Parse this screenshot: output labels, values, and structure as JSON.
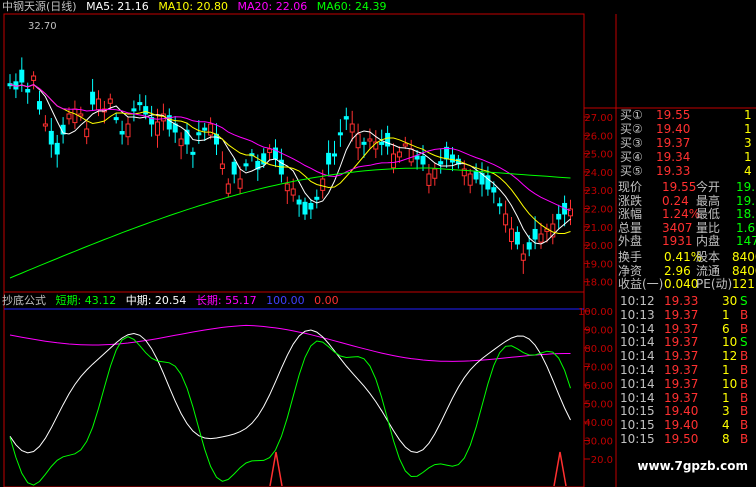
{
  "main_header": {
    "title": "中钢天源(日线)",
    "ma": [
      {
        "label": "MA5: 21.16",
        "color": "#ffffff"
      },
      {
        "label": "MA10: 20.80",
        "color": "#ffff00"
      },
      {
        "label": "MA20: 22.06",
        "color": "#ff00ff"
      },
      {
        "label": "MA60: 24.39",
        "color": "#00ff00"
      }
    ],
    "peak_label": "32.70",
    "low_marker": "18.92"
  },
  "price_axis": [
    "27.00",
    "26.00",
    "25.00",
    "24.00",
    "23.00",
    "22.00",
    "21.00",
    "20.00",
    "19.00",
    "18.00"
  ],
  "indicator_header": {
    "name": "抄底公式",
    "items": [
      {
        "label": "短期: 43.12",
        "color": "#00ff00"
      },
      {
        "label": "中期: 20.54",
        "color": "#ffffff"
      },
      {
        "label": "长期: 55.17",
        "color": "#ff00ff"
      },
      {
        "label": "100.00",
        "color": "#4040ff"
      },
      {
        "label": "0.00",
        "color": "#ff3030"
      }
    ]
  },
  "ind_axis": [
    "100.00",
    "90.00",
    "80.00",
    "70.00",
    "60.00",
    "50.00",
    "40.00",
    "30.00",
    "20.0"
  ],
  "quote_panel": {
    "buy": [
      {
        "label": "买①",
        "price": "19.55",
        "vol": "1"
      },
      {
        "label": "买②",
        "price": "19.40",
        "vol": "1"
      },
      {
        "label": "买③",
        "price": "19.37",
        "vol": "3"
      },
      {
        "label": "买④",
        "price": "19.34",
        "vol": "1"
      },
      {
        "label": "买⑤",
        "price": "19.33",
        "vol": "4"
      }
    ],
    "stats": [
      {
        "k1": "现价",
        "v1": "19.55",
        "k2": "今开",
        "v2": "19.7"
      },
      {
        "k1": "涨跌",
        "v1": "0.24",
        "k2": "最高",
        "v2": "19.9"
      },
      {
        "k1": "涨幅",
        "v1": "1.24%",
        "k2": "最低",
        "v2": "18.9"
      },
      {
        "k1": "总量",
        "v1": "3407",
        "k2": "量比",
        "v2": "1.6"
      },
      {
        "k1": "外盘",
        "v1": "1931",
        "k2": "内盘",
        "v2": "147"
      }
    ],
    "fund": [
      {
        "k1": "换手",
        "v1": "0.41%",
        "k2": "股本",
        "v2": "8400"
      },
      {
        "k1": "净资",
        "v1": "2.96",
        "k2": "流通",
        "v2": "8400"
      },
      {
        "k1": "收益(一)",
        "v1": "0.040",
        "k2": "PE(动)",
        "v2": "121"
      }
    ],
    "trades": [
      {
        "t": "10:12",
        "p": "19.33",
        "v": "30",
        "s": "S"
      },
      {
        "t": "10:13",
        "p": "19.37",
        "v": "1",
        "s": "B"
      },
      {
        "t": "10:14",
        "p": "19.37",
        "v": "6",
        "s": "B"
      },
      {
        "t": "10:14",
        "p": "19.37",
        "v": "10",
        "s": "S"
      },
      {
        "t": "10:14",
        "p": "19.37",
        "v": "12",
        "s": "B"
      },
      {
        "t": "10:14",
        "p": "19.37",
        "v": "1",
        "s": "B"
      },
      {
        "t": "10:14",
        "p": "19.37",
        "v": "10",
        "s": "B"
      },
      {
        "t": "10:14",
        "p": "19.37",
        "v": "1",
        "s": "B"
      },
      {
        "t": "10:15",
        "p": "19.40",
        "v": "3",
        "s": "B"
      },
      {
        "t": "10:15",
        "p": "19.40",
        "v": "4",
        "s": "B"
      },
      {
        "t": "10:15",
        "p": "19.50",
        "v": "8",
        "s": "B"
      }
    ]
  },
  "watermark": "www.7gpzb.com",
  "colors": {
    "up": "#ff3030",
    "down": "#00ffff",
    "axis": "#c00000",
    "text": "#c0c0c0",
    "yellow": "#ffff00",
    "green": "#00ff00"
  }
}
